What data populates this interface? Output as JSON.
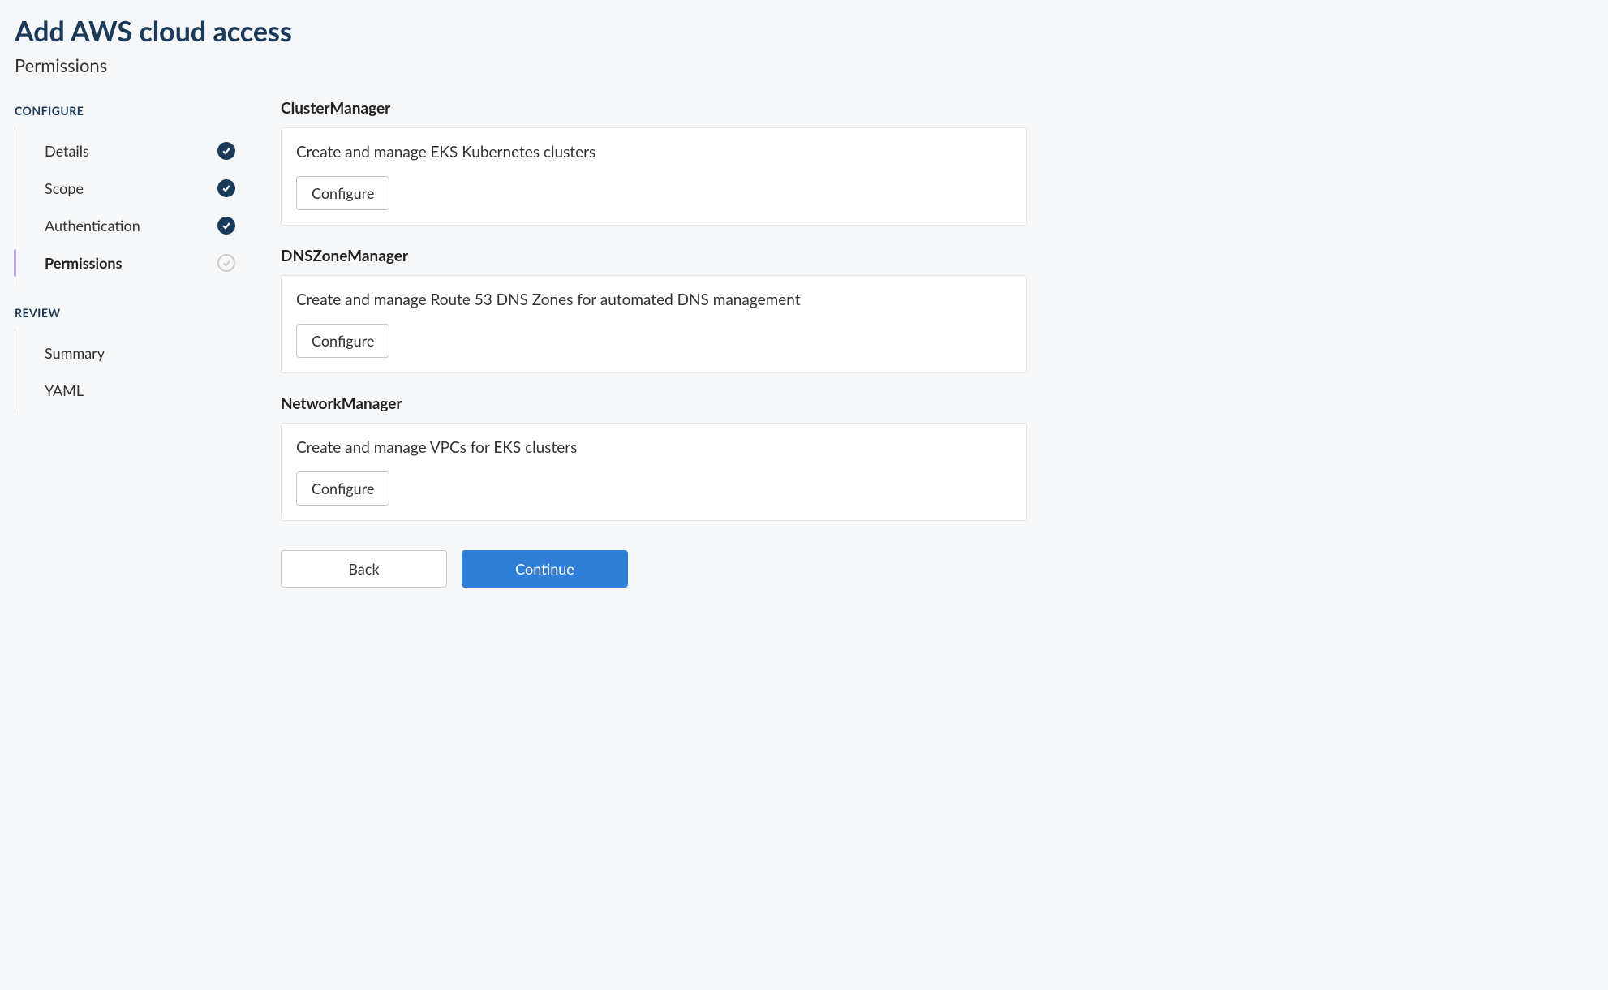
{
  "header": {
    "title": "Add AWS cloud access",
    "subtitle": "Permissions"
  },
  "sidebar": {
    "groups": [
      {
        "header": "CONFIGURE",
        "items": [
          {
            "label": "Details",
            "status": "done",
            "current": false
          },
          {
            "label": "Scope",
            "status": "done",
            "current": false
          },
          {
            "label": "Authentication",
            "status": "done",
            "current": false
          },
          {
            "label": "Permissions",
            "status": "pending",
            "current": true
          }
        ]
      },
      {
        "header": "REVIEW",
        "items": [
          {
            "label": "Summary",
            "status": "none",
            "current": false
          },
          {
            "label": "YAML",
            "status": "none",
            "current": false
          }
        ]
      }
    ]
  },
  "permissions": [
    {
      "name": "ClusterManager",
      "description": "Create and manage EKS Kubernetes clusters",
      "button": "Configure"
    },
    {
      "name": "DNSZoneManager",
      "description": "Create and manage Route 53 DNS Zones for automated DNS management",
      "button": "Configure"
    },
    {
      "name": "NetworkManager",
      "description": "Create and manage VPCs for EKS clusters",
      "button": "Configure"
    }
  ],
  "footer": {
    "back": "Back",
    "continue": "Continue"
  }
}
